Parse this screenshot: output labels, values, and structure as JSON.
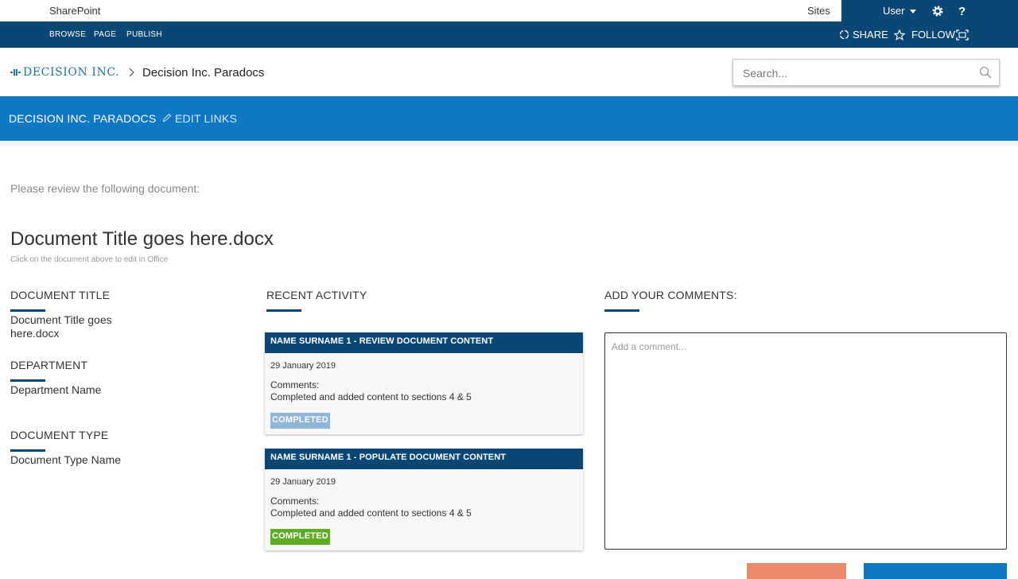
{
  "suite_bar": {
    "brand": "SharePoint",
    "sites_label": "Sites",
    "user_label": "User",
    "help_label": "?"
  },
  "ribbon": {
    "tabs": [
      "BROWSE",
      "PAGE",
      "PUBLISH"
    ],
    "share_label": "SHARE",
    "follow_label": "FOLLOW"
  },
  "header": {
    "logo_text": "DECISION INC.",
    "site_title": "Decision Inc. Paradocs",
    "search_placeholder": "Search..."
  },
  "site_nav": {
    "title": "DECISION INC. PARADOCS",
    "edit_links_label": "EDIT LINKS"
  },
  "main": {
    "intro": "Please review the following document:",
    "document_title": "Document Title goes here.docx",
    "document_hint": "Click on the document above to edit in Office"
  },
  "details": {
    "document_title_label": "DOCUMENT TITLE",
    "document_title_value": "Document Title goes here.docx",
    "department_label": "DEPARTMENT",
    "department_value": "Department Name",
    "document_type_label": "DOCUMENT TYPE",
    "document_type_value": "Document Type Name"
  },
  "activity": {
    "heading": "RECENT ACTIVITY",
    "items": [
      {
        "title": "NAME SURNAME 1 - REVIEW DOCUMENT CONTENT",
        "date": "29 January 2019",
        "comments_label": "Comments:",
        "comment_text": "Completed and added content to sections 4 & 5",
        "status": "COMPLETED",
        "status_color": "#8fb6d6"
      },
      {
        "title": "NAME SURNAME 1 - POPULATE DOCUMENT CONTENT",
        "date": "29 January 2019",
        "comments_label": "Comments:",
        "comment_text": "Completed and added content to sections 4 & 5",
        "status": "COMPLETED",
        "status_color": "#5fab24"
      }
    ]
  },
  "comments": {
    "heading": "ADD YOUR COMMENTS:",
    "placeholder": "Add a comment..."
  },
  "colors": {
    "dark_blue": "#0b4775",
    "site_nav_blue": "#0f78c4",
    "cancel_button": "#e98a6a",
    "submit_button": "#0f78c4"
  }
}
